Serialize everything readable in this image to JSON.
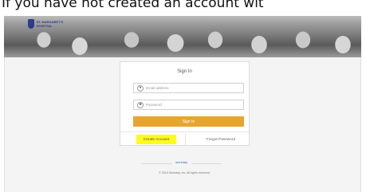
{
  "caption": "If you have not created an account wit",
  "header": {
    "logo_text": "ST. MARGARET'S HOSPITAL",
    "logo_icon": "shield-icon"
  },
  "signin": {
    "title": "Sign In",
    "email_placeholder": "Email address",
    "password_placeholder": "Password",
    "email_icon": "user-icon",
    "password_icon": "lock-icon",
    "button_label": "Sign In"
  },
  "links": {
    "create_account": "Create Account",
    "forgot_password": "Forgot Password"
  },
  "footer": {
    "brand": "workday.",
    "copyright": "© 2018 Workday, Inc. All rights reserved."
  },
  "colors": {
    "accent": "#e8a431",
    "highlight": "#fffb1a",
    "brand_blue": "#2b3d8f"
  }
}
